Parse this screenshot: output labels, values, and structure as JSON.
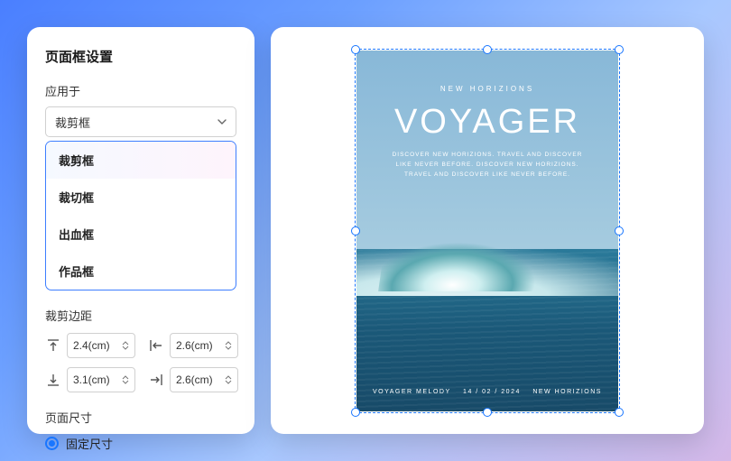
{
  "panel": {
    "title": "页面框设置",
    "apply_label": "应用于",
    "select_value": "裁剪框",
    "options": [
      "裁剪框",
      "裁切框",
      "出血框",
      "作品框"
    ],
    "margin_label": "裁剪边距",
    "margins": {
      "top": "2.4(cm)",
      "left": "2.6(cm)",
      "bottom": "3.1(cm)",
      "right": "2.6(cm)"
    },
    "size_label": "页面尺寸",
    "radio_fixed": "固定尺寸"
  },
  "artwork": {
    "eyebrow": "NEW HORIZIONS",
    "title": "VOYAGER",
    "subtitle": "DISCOVER NEW HORIZIONS. TRAVEL AND DISCOVER LIKE NEVER BEFORE. DISCOVER NEW HORIZIONS. TRAVEL AND DISCOVER LIKE NEVER BEFORE.",
    "footer_left": "VOYAGER MELODY",
    "footer_mid": "14 / 02 / 2024",
    "footer_right": "NEW HORIZIONS"
  }
}
